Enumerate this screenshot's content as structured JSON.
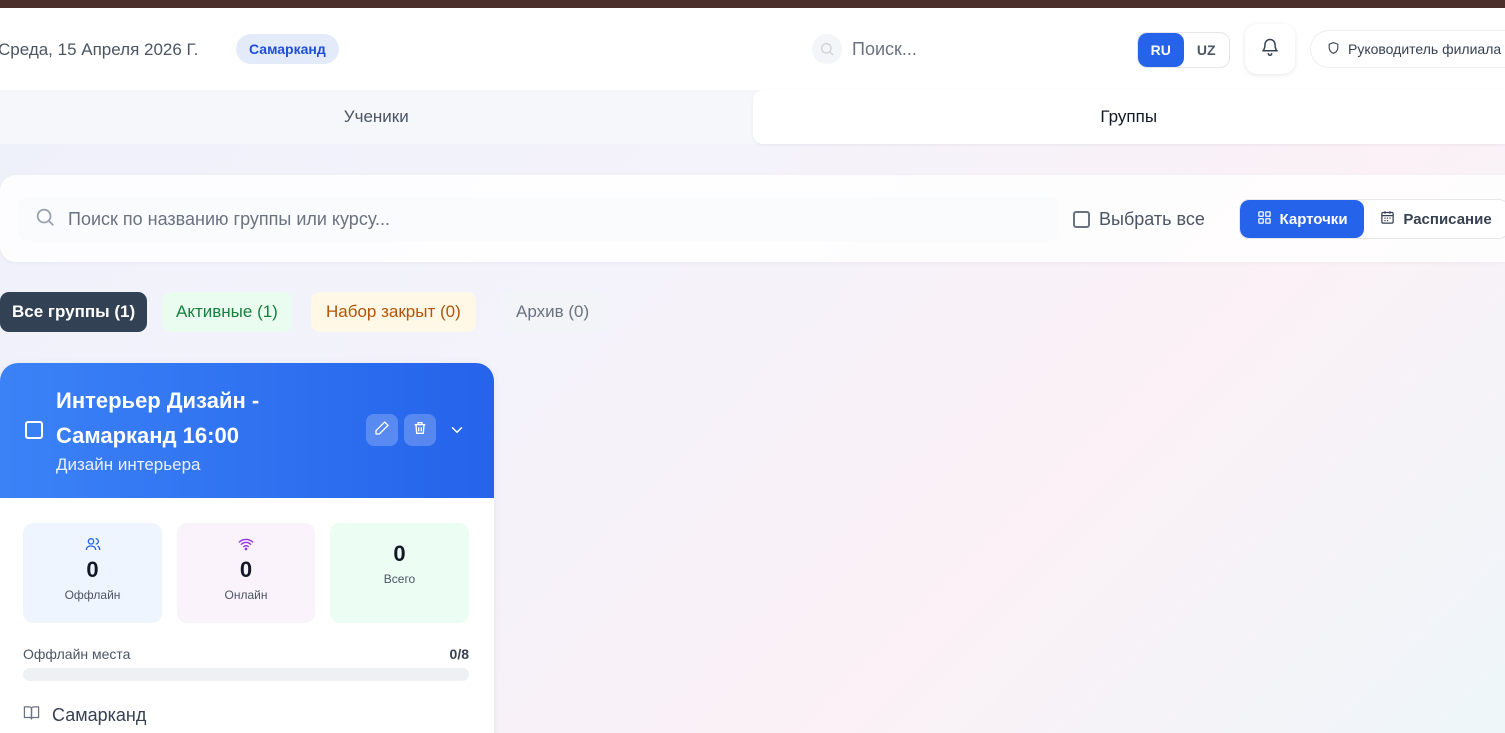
{
  "header": {
    "date": "Среда, 15 Апреля 2026 Г.",
    "city": "Самарканд",
    "search_placeholder": "Поиск...",
    "lang_ru": "RU",
    "lang_uz": "UZ",
    "active_lang": "RU",
    "role": "Руководитель филиала"
  },
  "tabs": [
    {
      "label": "Ученики",
      "active": false
    },
    {
      "label": "Группы",
      "active": true
    }
  ],
  "filters": {
    "search_placeholder": "Поиск по названию группы или курсу...",
    "select_all": "Выбрать все",
    "view_cards": "Карточки",
    "view_schedule": "Расписание",
    "active_view": "cards"
  },
  "chips": [
    {
      "label": "Все группы (1)"
    },
    {
      "label": "Активные (1)"
    },
    {
      "label": "Набор закрыт (0)"
    },
    {
      "label": "Архив (0)"
    }
  ],
  "group_card": {
    "title": "Интерьер Дизайн - Самарканд 16:00",
    "course": "Дизайн интерьера",
    "stats": {
      "offline": {
        "value": "0",
        "label": "Оффлайн",
        "icon": "users-icon"
      },
      "online": {
        "value": "0",
        "label": "Онлайн",
        "icon": "wifi-icon"
      },
      "total": {
        "value": "0",
        "label": "Всего"
      }
    },
    "places_label": "Оффлайн места",
    "places_value": "0/8",
    "places_fill": 0,
    "location": "Самарканд"
  },
  "colors": {
    "accent": "#2563eb",
    "top_strip": "#4a2f2a",
    "chip_all_bg": "#334155"
  }
}
